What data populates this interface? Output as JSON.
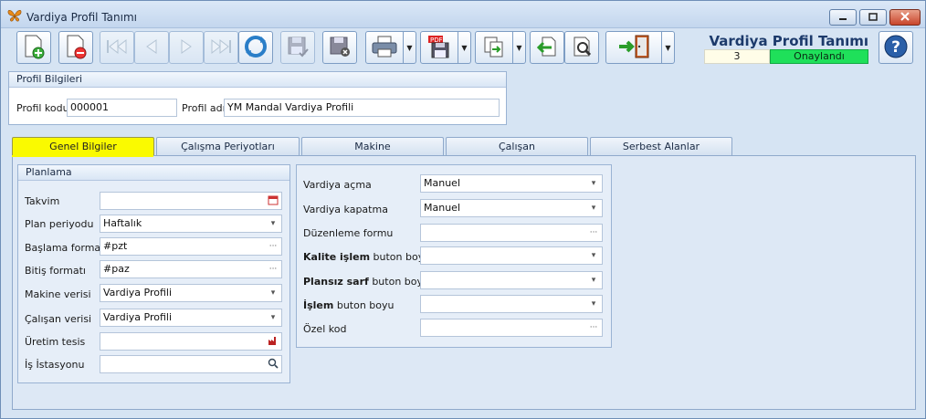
{
  "window": {
    "title": "Vardiya Profil Tanımı",
    "icon": "butterfly-icon",
    "controls": [
      "minimize-icon",
      "maximize-icon",
      "close-icon"
    ]
  },
  "toolbar": {
    "buttons": [
      {
        "name": "new-record",
        "icon": "document-add-icon",
        "enabled": true
      },
      {
        "name": "delete-record",
        "icon": "document-delete-icon",
        "enabled": true
      },
      {
        "name": "first-record",
        "icon": "skip-first-icon",
        "enabled": false
      },
      {
        "name": "prev-record",
        "icon": "prev-icon",
        "enabled": false
      },
      {
        "name": "next-record",
        "icon": "next-icon",
        "enabled": false
      },
      {
        "name": "last-record",
        "icon": "skip-last-icon",
        "enabled": false
      },
      {
        "name": "refresh",
        "icon": "refresh-icon",
        "enabled": true
      },
      {
        "name": "save",
        "icon": "floppy-check-icon",
        "enabled": false
      },
      {
        "name": "cancel",
        "icon": "floppy-cancel-icon",
        "enabled": false
      },
      {
        "name": "print",
        "icon": "printer-icon",
        "enabled": true,
        "dropdown": true
      },
      {
        "name": "export-pdf",
        "icon": "pdf-save-icon",
        "enabled": true,
        "dropdown": true
      },
      {
        "name": "copy",
        "icon": "copy-icon",
        "enabled": true,
        "dropdown": true
      },
      {
        "name": "import",
        "icon": "import-icon",
        "enabled": true
      },
      {
        "name": "tools",
        "icon": "tools-icon",
        "enabled": true
      },
      {
        "name": "exit",
        "icon": "exit-door-icon",
        "enabled": true,
        "dropdown": true
      }
    ]
  },
  "header": {
    "title": "Vardiya Profil Tanımı",
    "record_no": "3",
    "status": "Onaylandı",
    "status_color": "#1fe05a",
    "help_icon": "help-icon"
  },
  "profile": {
    "heading": "Profil Bilgileri",
    "code_label": "Profil kodu",
    "code_value": "000001",
    "name_label": "Profil adı",
    "name_value": "YM Mandal Vardiya Profili"
  },
  "tabs": [
    {
      "label": "Genel Bilgiler",
      "active": true
    },
    {
      "label": "Çalışma Periyotları",
      "active": false
    },
    {
      "label": "Makine",
      "active": false
    },
    {
      "label": "Çalışan",
      "active": false
    },
    {
      "label": "Serbest Alanlar",
      "active": false
    }
  ],
  "planning": {
    "heading": "Planlama",
    "fields": [
      {
        "label": "Takvim",
        "value": "",
        "control": "calendar-icon"
      },
      {
        "label": "Plan periyodu",
        "value": "Haftalık",
        "control": "dropdown"
      },
      {
        "label": "Başlama formatı",
        "value": "#pzt",
        "control": "ellipsis"
      },
      {
        "label": "Bitiş formatı",
        "value": "#paz",
        "control": "ellipsis"
      },
      {
        "label": "Makine verisi",
        "value": "Vardiya Profili",
        "control": "dropdown"
      },
      {
        "label": "Çalışan verisi",
        "value": "Vardiya Profili",
        "control": "dropdown"
      },
      {
        "label": "Üretim tesis",
        "value": "",
        "control": "factory-icon"
      },
      {
        "label": "İş İstasyonu",
        "value": "",
        "control": "search-icon"
      }
    ]
  },
  "shift": {
    "fields": [
      {
        "label": "Vardiya açma",
        "value": "Manuel",
        "control": "dropdown"
      },
      {
        "label": "Vardiya kapatma",
        "value": "Manuel",
        "control": "dropdown"
      },
      {
        "label": "Düzenleme formu",
        "value": "",
        "control": "ellipsis"
      },
      {
        "label_bold": "Kalite işlem",
        "label_rest": " buton boyu",
        "value": "",
        "control": "dropdown"
      },
      {
        "label_bold": "Plansız sarf",
        "label_rest": " buton boyu",
        "value": "",
        "control": "dropdown"
      },
      {
        "label_bold": "İşlem",
        "label_rest": " buton boyu",
        "value": "",
        "control": "dropdown"
      },
      {
        "label": "Özel kod",
        "value": "",
        "control": "ellipsis"
      }
    ]
  }
}
